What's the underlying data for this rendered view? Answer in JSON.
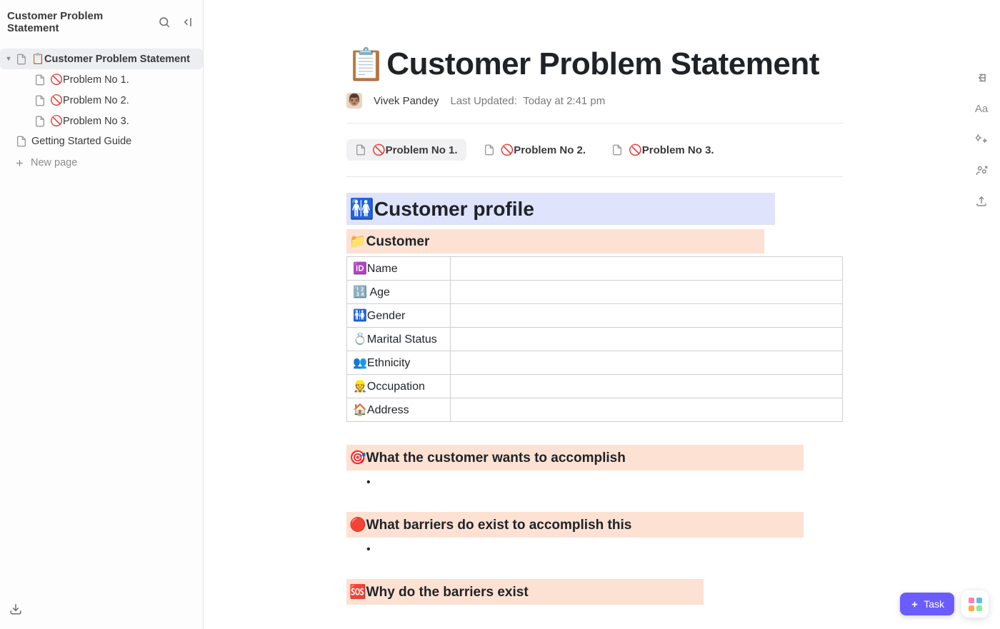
{
  "sidebar": {
    "title": "Customer Problem Statement",
    "nav": {
      "rootLabel": "📋Customer Problem Statement",
      "children": [
        {
          "label": "🚫Problem No 1."
        },
        {
          "label": "🚫Problem No 2."
        },
        {
          "label": "🚫Problem No 3."
        }
      ],
      "guide": "Getting Started Guide",
      "newPage": "New page"
    }
  },
  "doc": {
    "titleIcon": "📋",
    "title": "Customer Problem Statement",
    "author": "Vivek Pandey",
    "updatedLabel": "Last Updated:",
    "updatedValue": "Today at 2:41 pm",
    "chips": [
      {
        "label": "🚫Problem No 1."
      },
      {
        "label": "🚫Problem No 2."
      },
      {
        "label": "🚫Problem No 3."
      }
    ],
    "sections": {
      "profileHeading": "🚻Customer profile",
      "customerHeading": "📁Customer",
      "table": [
        {
          "label": "🆔Name"
        },
        {
          "label": "🔢 Age"
        },
        {
          "label": "🚻Gender"
        },
        {
          "label": "💍Marital Status"
        },
        {
          "label": "👥Ethnicity"
        },
        {
          "label": "👷Occupation"
        },
        {
          "label": "🏠Address"
        }
      ],
      "q1": "🎯What the customer wants to accomplish",
      "q2": "🔴What barriers do exist to accomplish this",
      "q3": "🆘Why do the barriers exist"
    }
  },
  "fab": {
    "task": "Task"
  }
}
